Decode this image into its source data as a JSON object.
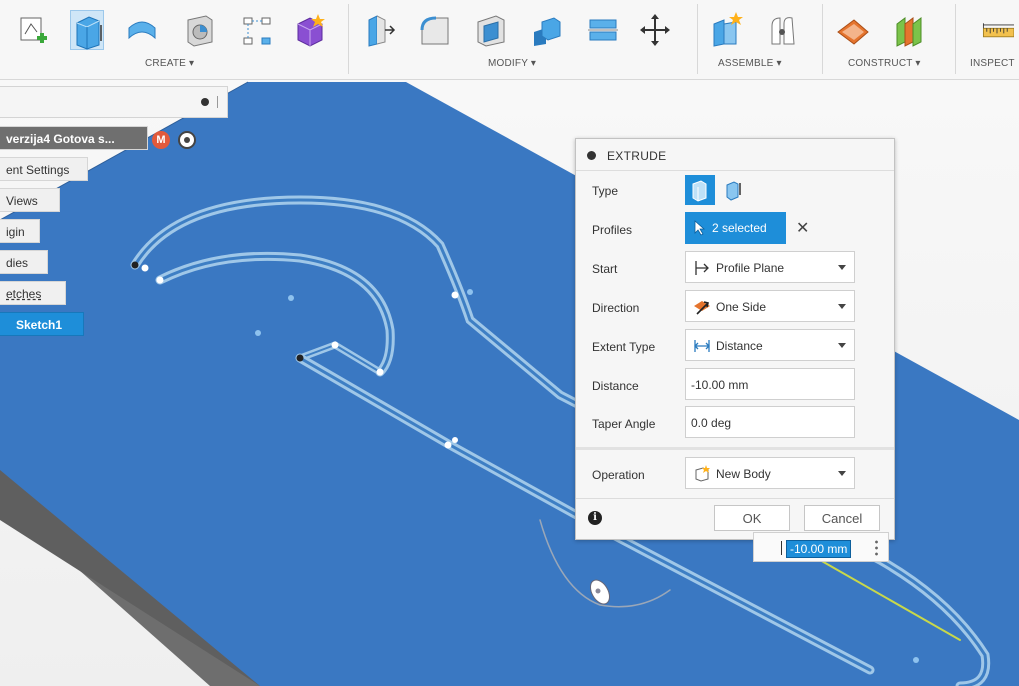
{
  "toolbar": {
    "groups": [
      {
        "label": "CREATE ▾"
      },
      {
        "label": "MODIFY ▾"
      },
      {
        "label": "ASSEMBLE ▾"
      },
      {
        "label": "CONSTRUCT ▾"
      },
      {
        "label": "INSPECT"
      }
    ],
    "icons": [
      "create-sketch-icon",
      "extrude-icon",
      "revolve-icon",
      "hole-icon",
      "pattern-icon",
      "create-form-icon",
      "press-pull-icon",
      "fillet-icon",
      "shell-icon",
      "combine-icon",
      "split-icon",
      "move-icon",
      "new-component-icon",
      "joint-icon",
      "offset-plane-icon",
      "midplane-icon",
      "measure-icon"
    ]
  },
  "browser": {
    "root_label": "verzija4 Gotova s...",
    "root_badge": "M",
    "items": [
      {
        "label": "ent Settings"
      },
      {
        "label": "Views"
      },
      {
        "label": "igin"
      },
      {
        "label": "dies"
      },
      {
        "label": "etches"
      },
      {
        "label": "Sketch1"
      }
    ]
  },
  "dialog": {
    "title": "EXTRUDE",
    "rows": {
      "type": {
        "label": "Type"
      },
      "profiles": {
        "label": "Profiles",
        "value": "2 selected"
      },
      "start": {
        "label": "Start",
        "value": "Profile Plane"
      },
      "direction": {
        "label": "Direction",
        "value": "One Side"
      },
      "extent_type": {
        "label": "Extent Type",
        "value": "Distance"
      },
      "distance": {
        "label": "Distance",
        "value": "-10.00 mm"
      },
      "taper_angle": {
        "label": "Taper Angle",
        "value": "0.0 deg"
      },
      "operation": {
        "label": "Operation",
        "value": "New Body"
      }
    },
    "ok_label": "OK",
    "cancel_label": "Cancel",
    "info_glyph": "i"
  },
  "dimension_input": {
    "value": "-10.00 mm"
  },
  "colors": {
    "accent": "#1e8ed9",
    "plate_top": "#3a78c2",
    "plate_side": "#6b6b6b"
  }
}
